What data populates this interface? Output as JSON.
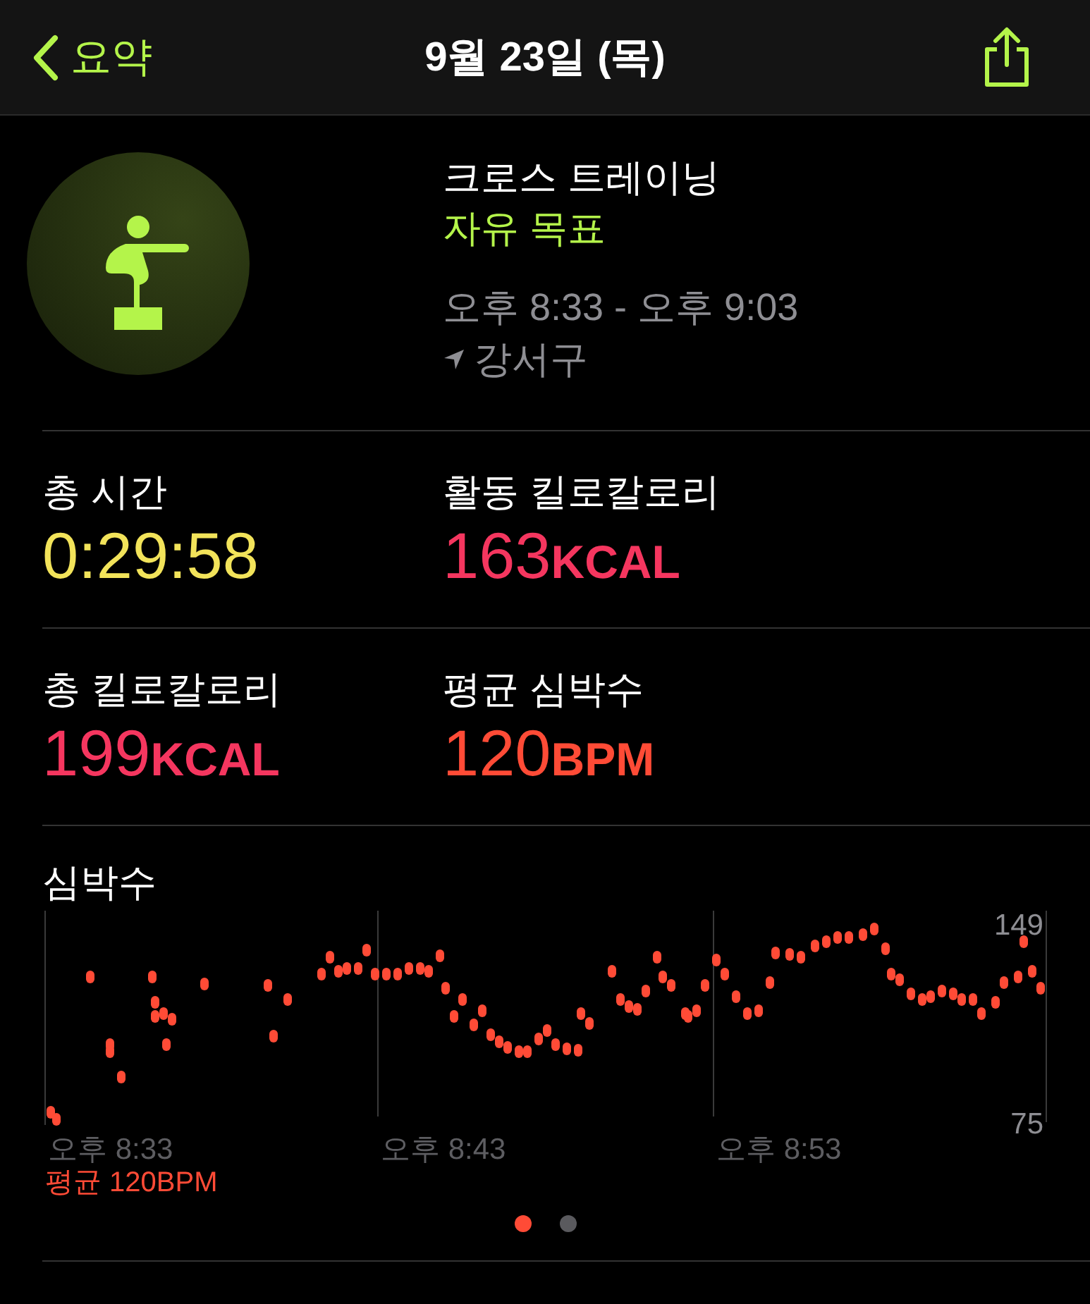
{
  "header": {
    "back_label": "요약",
    "title": "9월 23일 (목)"
  },
  "workout": {
    "name": "크로스 트레이닝",
    "goal": "자유 목표",
    "time_range": "오후 8:33 - 오후 9:03",
    "location": "강서구"
  },
  "metrics": [
    {
      "label": "총 시간",
      "value": "0:29:58",
      "color": "#f2e35a"
    },
    {
      "label": "활동 킬로칼로리",
      "value": "163",
      "unit": "KCAL",
      "color": "#f5365f"
    },
    {
      "label": "총 킬로칼로리",
      "value": "199",
      "unit": "KCAL",
      "color": "#f5365f"
    },
    {
      "label": "평균 심박수",
      "value": "120",
      "unit": "BPM",
      "color": "#ff4b36"
    }
  ],
  "heart_rate": {
    "title": "심박수",
    "x_labels": [
      "오후 8:33",
      "오후 8:43",
      "오후 8:53"
    ],
    "y_labels": [
      "149",
      "75"
    ],
    "average": "평균 120BPM"
  },
  "pages": [
    {
      "selected": true
    },
    {
      "selected": false
    }
  ]
}
